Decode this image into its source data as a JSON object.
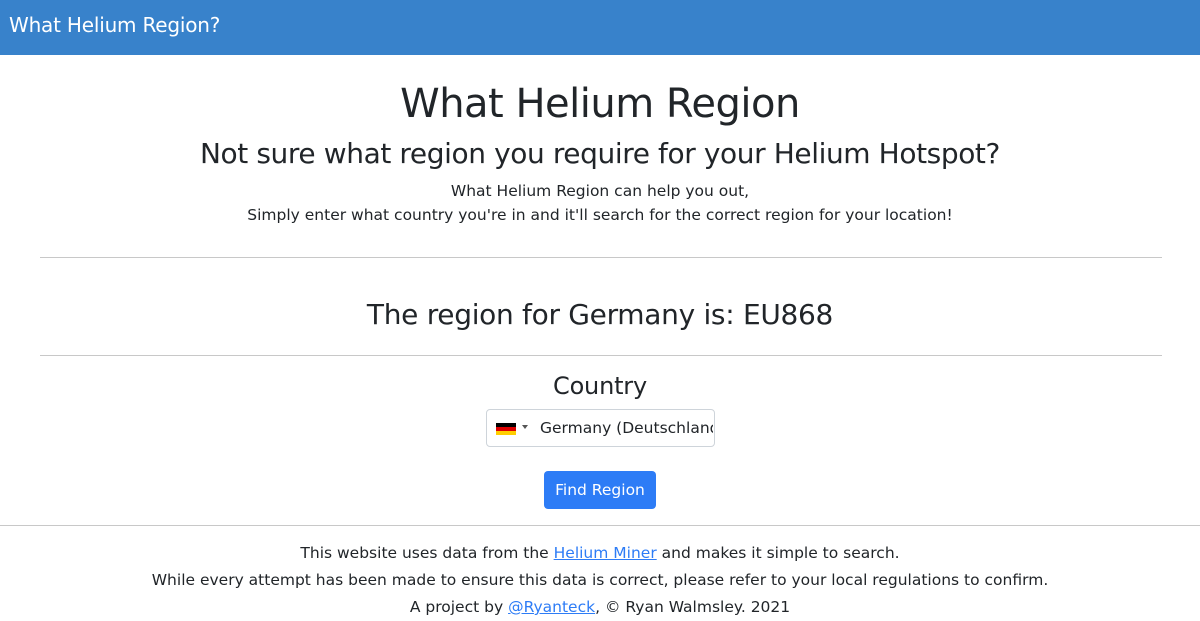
{
  "navbar": {
    "brand": "What Helium Region?"
  },
  "header": {
    "title": "What Helium Region",
    "subtitle": "Not sure what region you require for your Helium Hotspot?",
    "intro_line_1": "What Helium Region can help you out,",
    "intro_line_2": "Simply enter what country you're in and it'll search for the correct region for your location!"
  },
  "result": {
    "text": "The region for Germany is: EU868"
  },
  "form": {
    "country_label": "Country",
    "country_value": "Germany (Deutschland)",
    "selected_flag": "germany-flag-icon",
    "flag_colors": [
      "#000000",
      "#dd0000",
      "#ffce00"
    ],
    "submit_label": "Find Region"
  },
  "footer": {
    "line1_prefix": "This website uses data from the ",
    "line1_link": "Helium Miner",
    "line1_suffix": " and makes it simple to search.",
    "line2": "While every attempt has been made to ensure this data is correct, please refer to your local regulations to confirm.",
    "line3_prefix": "A project by ",
    "line3_link": "@Ryanteck",
    "line3_suffix": ", © Ryan Walmsley. 2021"
  },
  "colors": {
    "navbar": "#3882cb",
    "button": "#2d7cf6",
    "link": "#2d7cf6",
    "text": "#212529",
    "rule": "#c8c8c8"
  }
}
